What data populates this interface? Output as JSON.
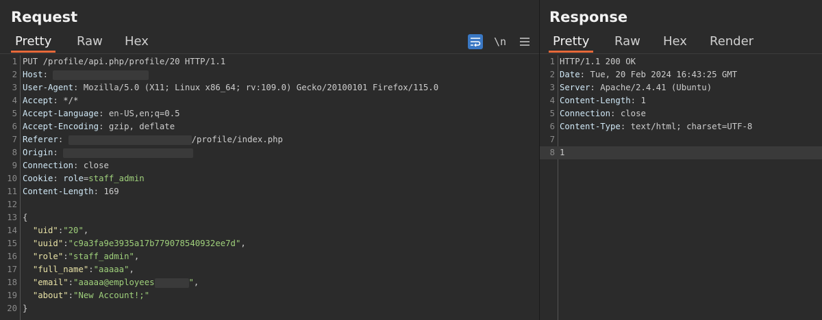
{
  "request": {
    "title": "Request",
    "tabs": [
      "Pretty",
      "Raw",
      "Hex"
    ],
    "active_tab": "Pretty",
    "toolbar": {
      "wrap_icon": "wrap-lines-icon",
      "newline_label": "\\n",
      "menu_icon": "hamburger-menu-icon"
    },
    "lines": [
      {
        "n": "1",
        "text": "PUT /profile/api.php/profile/20 HTTP/1.1"
      },
      {
        "n": "2",
        "name": "Host",
        "value": ""
      },
      {
        "n": "3",
        "name": "User-Agent",
        "value": "Mozilla/5.0 (X11; Linux x86_64; rv:109.0) Gecko/20100101 Firefox/115.0"
      },
      {
        "n": "4",
        "name": "Accept",
        "value": "*/*"
      },
      {
        "n": "5",
        "name": "Accept-Language",
        "value": "en-US,en;q=0.5"
      },
      {
        "n": "6",
        "name": "Accept-Encoding",
        "value": "gzip, deflate"
      },
      {
        "n": "7",
        "name": "Referer",
        "value": "/profile/index.php"
      },
      {
        "n": "8",
        "name": "Origin",
        "value": ""
      },
      {
        "n": "9",
        "name": "Connection",
        "value": "close"
      },
      {
        "n": "10",
        "name": "Cookie",
        "cookie_key": "role",
        "cookie_value": "staff_admin"
      },
      {
        "n": "11",
        "name": "Content-Length",
        "value": "169"
      },
      {
        "n": "12",
        "text": ""
      },
      {
        "n": "13",
        "text": "{"
      },
      {
        "n": "14",
        "key": "\"uid\"",
        "value": "\"20\"",
        "trail": ","
      },
      {
        "n": "15",
        "key": "\"uuid\"",
        "value": "\"c9a3fa9e3935a17b779078540932ee7d\"",
        "trail": ","
      },
      {
        "n": "16",
        "key": "\"role\"",
        "value": "\"staff_admin\"",
        "trail": ","
      },
      {
        "n": "17",
        "key": "\"full_name\"",
        "value": "\"aaaaa\"",
        "trail": ","
      },
      {
        "n": "18",
        "key": "\"email\"",
        "value": "\"aaaaa@employees",
        "value_end": "\"",
        "trail": ","
      },
      {
        "n": "19",
        "key": "\"about\"",
        "value": "\"New Account!;\"",
        "trail": ""
      },
      {
        "n": "20",
        "text": "}"
      }
    ]
  },
  "response": {
    "title": "Response",
    "tabs": [
      "Pretty",
      "Raw",
      "Hex",
      "Render"
    ],
    "active_tab": "Pretty",
    "lines": [
      {
        "n": "1",
        "text": "HTTP/1.1 200 OK"
      },
      {
        "n": "2",
        "name": "Date",
        "value": "Tue, 20 Feb 2024 16:43:25 GMT"
      },
      {
        "n": "3",
        "name": "Server",
        "value": "Apache/2.4.41 (Ubuntu)"
      },
      {
        "n": "4",
        "name": "Content-Length",
        "value": "1"
      },
      {
        "n": "5",
        "name": "Connection",
        "value": "close"
      },
      {
        "n": "6",
        "name": "Content-Type",
        "value": "text/html; charset=UTF-8"
      },
      {
        "n": "7",
        "text": ""
      },
      {
        "n": "8",
        "text": "1"
      }
    ]
  }
}
